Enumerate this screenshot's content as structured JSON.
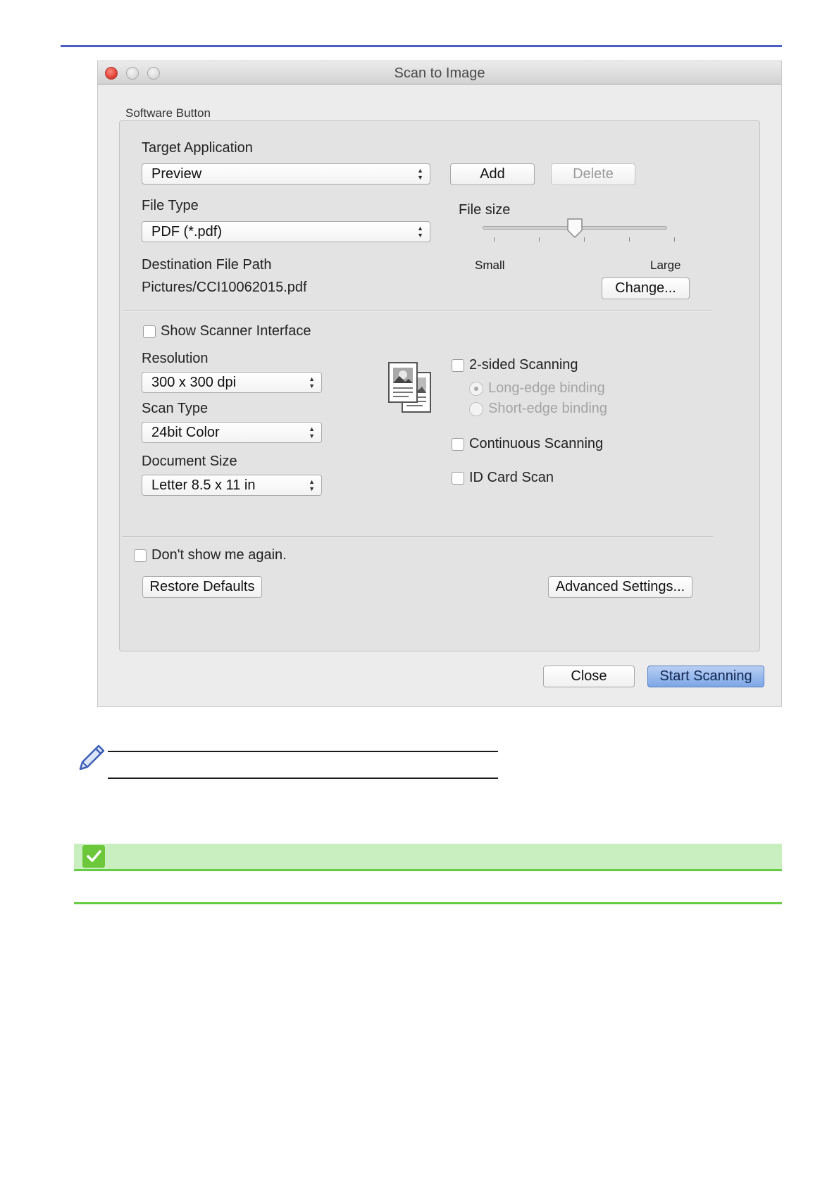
{
  "window": {
    "title": "Scan to Image",
    "group_label": "Software Button"
  },
  "target_application": {
    "label": "Target Application",
    "value": "Preview",
    "add_label": "Add",
    "delete_label": "Delete"
  },
  "file_type": {
    "label": "File Type",
    "value": "PDF (*.pdf)"
  },
  "file_size": {
    "label": "File size",
    "min_label": "Small",
    "max_label": "Large",
    "level": 0.5
  },
  "destination": {
    "label": "Destination File Path",
    "value": "Pictures/CCI10062015.pdf",
    "change_label": "Change..."
  },
  "options": {
    "show_scanner_interface": "Show Scanner Interface",
    "resolution_label": "Resolution",
    "resolution_value": "300 x 300 dpi",
    "scan_type_label": "Scan Type",
    "scan_type_value": "24bit Color",
    "document_size_label": "Document Size",
    "document_size_value": "Letter 8.5 x 11 in",
    "two_sided": "2-sided Scanning",
    "long_edge": "Long-edge binding",
    "short_edge": "Short-edge binding",
    "continuous": "Continuous Scanning",
    "id_card": "ID Card Scan"
  },
  "footer": {
    "dont_show": "Don't show me again.",
    "restore_defaults": "Restore Defaults",
    "advanced_settings": "Advanced Settings...",
    "close": "Close",
    "start_scanning": "Start Scanning"
  },
  "colors": {
    "top_rule": "#4a5fc1",
    "related_bar": "#c9eebf",
    "related_accent": "#66cc44",
    "default_button": "#7da6e6"
  }
}
